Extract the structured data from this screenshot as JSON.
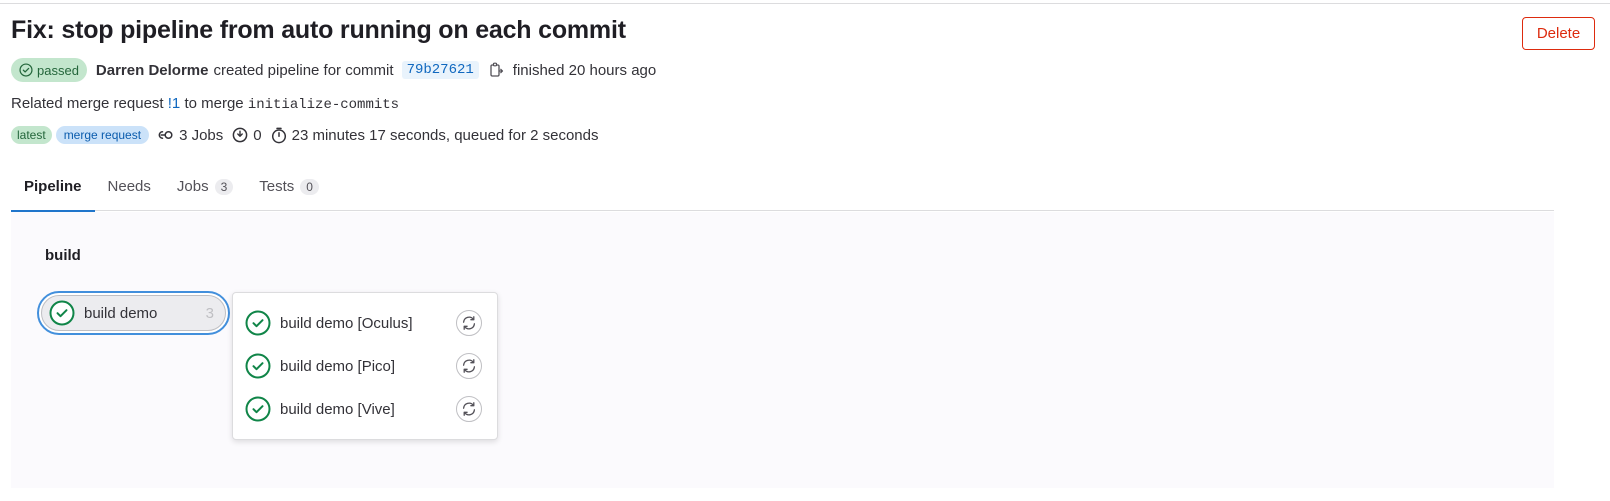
{
  "header": {
    "title": "Fix: stop pipeline from auto running on each commit",
    "delete_label": "Delete"
  },
  "meta": {
    "status": "passed",
    "author": "Darren Delorme",
    "action_text": "created pipeline for commit",
    "commit_sha": "79b27621",
    "finished_text": "finished 20 hours ago"
  },
  "related": {
    "prefix": "Related merge request",
    "mr_ref": "!1",
    "mid_text": "to merge",
    "branch": "initialize-commits"
  },
  "info": {
    "tag_latest": "latest",
    "tag_merge_request": "merge request",
    "jobs_text": "3 Jobs",
    "warnings_count": "0",
    "duration_text": "23 minutes 17 seconds, queued for 2 seconds"
  },
  "tabs": [
    {
      "label": "Pipeline"
    },
    {
      "label": "Needs"
    },
    {
      "label": "Jobs",
      "count": "3"
    },
    {
      "label": "Tests",
      "count": "0"
    }
  ],
  "pipeline": {
    "stage_name": "build",
    "job_group": {
      "label": "build demo",
      "count": "3"
    },
    "jobs": [
      {
        "label": "build demo [Oculus]"
      },
      {
        "label": "build demo [Pico]"
      },
      {
        "label": "build demo [Vive]"
      }
    ]
  },
  "colors": {
    "success": "#108548",
    "danger": "#dd2b0e",
    "link": "#1068bf",
    "focus": "#428fdc"
  }
}
